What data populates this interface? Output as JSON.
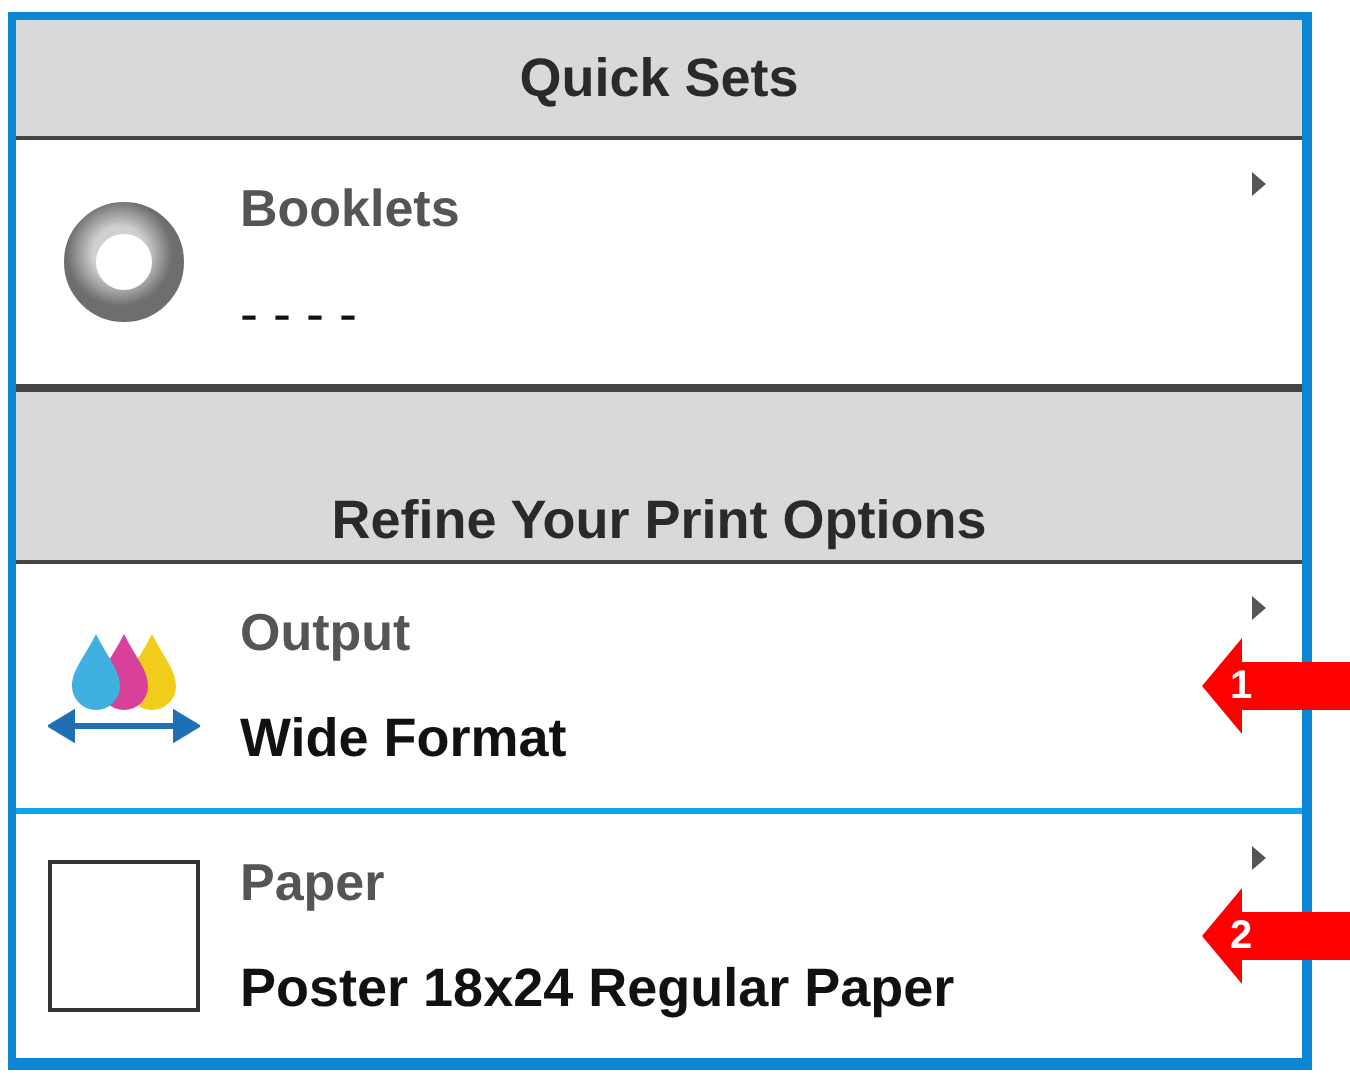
{
  "sections": [
    {
      "title": "Quick Sets",
      "items": [
        {
          "label": "Booklets",
          "value": "- - - -",
          "kind": "ring"
        }
      ]
    },
    {
      "title": "Refine Your Print Options",
      "items": [
        {
          "label": "Output",
          "value": "Wide Format",
          "kind": "ink",
          "callout": "1"
        },
        {
          "label": "Paper",
          "value": "Poster 18x24 Regular Paper",
          "kind": "blank",
          "callout": "2"
        }
      ]
    }
  ]
}
